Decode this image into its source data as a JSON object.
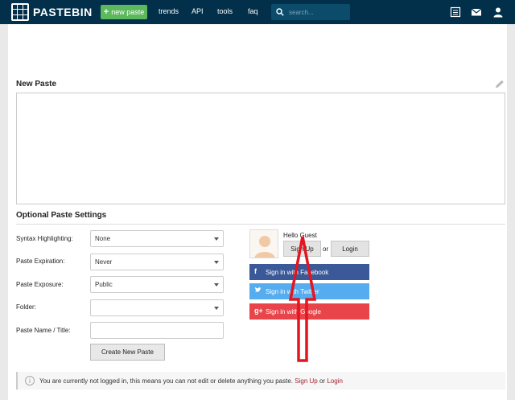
{
  "topbar": {
    "logo_text": "PASTEBIN",
    "new_paste_label": "new paste",
    "nav": [
      "trends",
      "API",
      "tools",
      "faq"
    ],
    "search_placeholder": "search...",
    "icons": [
      "list-icon",
      "mail-icon",
      "user-icon"
    ]
  },
  "paste": {
    "title": "New Paste",
    "content": ""
  },
  "settings": {
    "title": "Optional Paste Settings",
    "syntax_label": "Syntax Highlighting:",
    "syntax_value": "None",
    "expiration_label": "Paste Expiration:",
    "expiration_value": "Never",
    "exposure_label": "Paste Exposure:",
    "exposure_value": "Public",
    "folder_label": "Folder:",
    "folder_value": "",
    "name_label": "Paste Name / Title:",
    "name_value": "",
    "create_label": "Create New Paste"
  },
  "account": {
    "hello": "Hello Guest",
    "signup_label": "Sign Up",
    "or_text": "or",
    "login_label": "Login",
    "facebook_label": "Sign in with Facebook",
    "twitter_label": "Sign in with Twitter",
    "google_label": "Sign in with Google",
    "colors": {
      "facebook": "#3b5998",
      "twitter": "#55acee",
      "google": "#dd4b39"
    }
  },
  "notice": {
    "text": "You are currently not logged in, this means you can not edit or delete anything you paste.",
    "signup_link": "Sign Up",
    "or_text": "or",
    "login_link": "Login"
  }
}
